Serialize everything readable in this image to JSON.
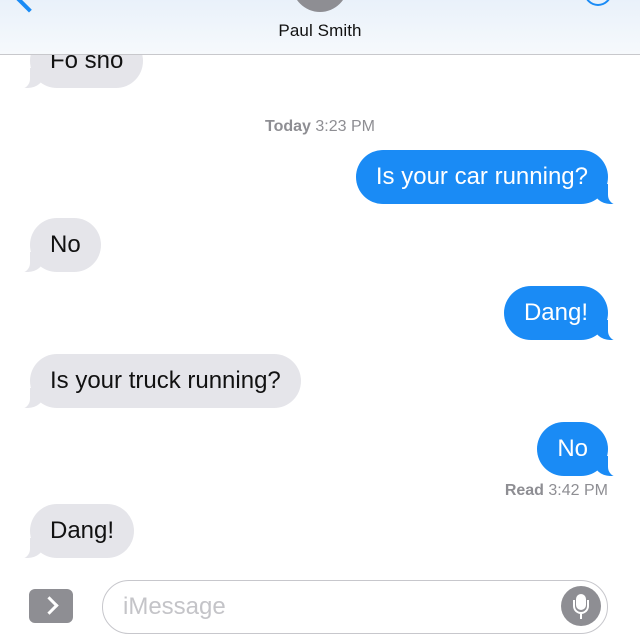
{
  "header": {
    "contact_name": "Paul Smith"
  },
  "thread": {
    "timestamp": {
      "day": "Today",
      "time": "3:23 PM"
    },
    "messages": [
      {
        "from": "them",
        "text": "Fo sho"
      },
      {
        "from": "me",
        "text": "Is your car running?"
      },
      {
        "from": "them",
        "text": "No"
      },
      {
        "from": "me",
        "text": "Dang!"
      },
      {
        "from": "them",
        "text": "Is your truck running?"
      },
      {
        "from": "me",
        "text": "No"
      },
      {
        "from": "them",
        "text": "Dang!"
      }
    ],
    "read_receipt": {
      "label": "Read",
      "time": "3:42 PM"
    }
  },
  "composer": {
    "placeholder": "iMessage"
  },
  "icons": {
    "back": "chevron-left-icon",
    "info": "info-icon",
    "apps": "chevron-right-icon",
    "mic": "microphone-icon"
  },
  "colors": {
    "outgoing_bubble": "#1a8bf5",
    "incoming_bubble": "#e5e5ea",
    "meta_text": "#8e8e93"
  }
}
